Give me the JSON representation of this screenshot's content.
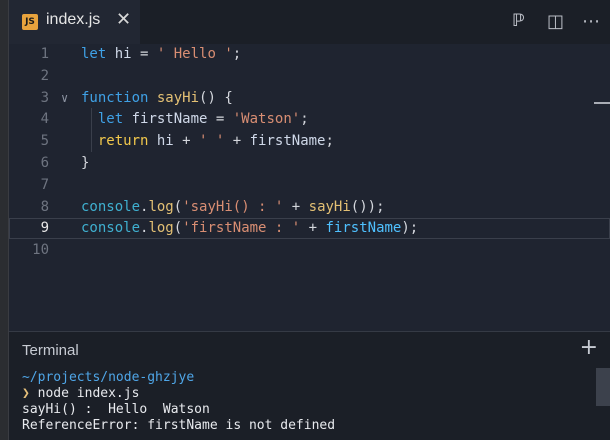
{
  "tab": {
    "badge": "JS",
    "filename": "index.js",
    "close_glyph": "✕"
  },
  "toolbar": {
    "icons": [
      "open-preview-icon",
      "split-editor-icon",
      "more-actions-icon"
    ],
    "glyphs": {
      "preview": "ℙ",
      "split": "◫",
      "more": "⋯"
    }
  },
  "editor": {
    "active_line": 9,
    "lines": [
      {
        "num": "1",
        "parts": [
          [
            "kw",
            "let"
          ],
          [
            "plain",
            " "
          ],
          [
            "id",
            "hi"
          ],
          [
            "plain",
            " = "
          ],
          [
            "str",
            "' Hello '"
          ],
          [
            "plain",
            ";"
          ]
        ]
      },
      {
        "num": "2",
        "parts": []
      },
      {
        "num": "3",
        "fold": "∨",
        "parts": [
          [
            "kw",
            "function"
          ],
          [
            "plain",
            " "
          ],
          [
            "fn",
            "sayHi"
          ],
          [
            "plain",
            "() {"
          ]
        ]
      },
      {
        "num": "4",
        "parts": [
          [
            "plain",
            "  "
          ],
          [
            "kw",
            "let"
          ],
          [
            "plain",
            " "
          ],
          [
            "id",
            "firstName"
          ],
          [
            "plain",
            " = "
          ],
          [
            "str",
            "'Watson'"
          ],
          [
            "plain",
            ";"
          ]
        ]
      },
      {
        "num": "5",
        "parts": [
          [
            "plain",
            "  "
          ],
          [
            "kw2",
            "return"
          ],
          [
            "plain",
            " "
          ],
          [
            "id",
            "hi"
          ],
          [
            "plain",
            " + "
          ],
          [
            "str",
            "' '"
          ],
          [
            "plain",
            " + "
          ],
          [
            "id",
            "firstName"
          ],
          [
            "plain",
            ";"
          ]
        ]
      },
      {
        "num": "6",
        "parts": [
          [
            "plain",
            "}"
          ]
        ]
      },
      {
        "num": "7",
        "parts": []
      },
      {
        "num": "8",
        "parts": [
          [
            "obj",
            "console"
          ],
          [
            "plain",
            "."
          ],
          [
            "fn",
            "log"
          ],
          [
            "plain",
            "("
          ],
          [
            "str",
            "'sayHi() : '"
          ],
          [
            "plain",
            " + "
          ],
          [
            "fn",
            "sayHi"
          ],
          [
            "plain",
            "());"
          ]
        ]
      },
      {
        "num": "9",
        "parts": [
          [
            "obj",
            "console"
          ],
          [
            "plain",
            "."
          ],
          [
            "fn",
            "log"
          ],
          [
            "plain",
            "("
          ],
          [
            "str",
            "'firstName : '"
          ],
          [
            "plain",
            " + "
          ],
          [
            "prop",
            "firstName"
          ],
          [
            "plain",
            ");"
          ]
        ]
      },
      {
        "num": "10",
        "parts": []
      }
    ]
  },
  "terminal": {
    "title": "Terminal",
    "add_glyph": "+",
    "path": "~/projects/node-ghzjye",
    "prompt_glyph": "❯",
    "command": "node index.js",
    "output": [
      "sayHi() :  Hello  Watson",
      "ReferenceError: firstName is not defined"
    ]
  }
}
